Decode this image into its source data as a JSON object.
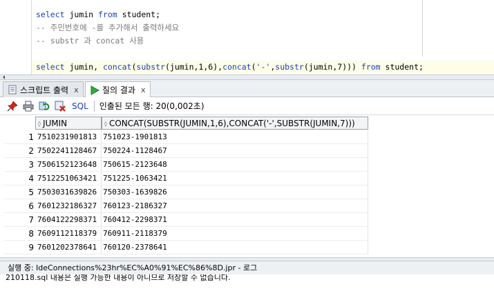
{
  "editor": {
    "lines": [
      {
        "parts": [
          {
            "t": "kw",
            "v": "select"
          },
          {
            "t": "id",
            "v": " jumin "
          },
          {
            "t": "kw",
            "v": "from"
          },
          {
            "t": "id",
            "v": " student;"
          }
        ]
      },
      {
        "parts": [
          {
            "t": "cmt",
            "v": "-- 주민번호에 -를 추가해서 출력하세요"
          }
        ]
      },
      {
        "parts": [
          {
            "t": "cmt",
            "v": "-- substr 과 concat 사용"
          }
        ]
      },
      {
        "parts": [
          {
            "t": "kw",
            "v": "select"
          },
          {
            "t": "id",
            "v": " jumin, "
          },
          {
            "t": "kw",
            "v": "concat"
          },
          {
            "t": "id",
            "v": "("
          },
          {
            "t": "kw",
            "v": "substr"
          },
          {
            "t": "id",
            "v": "(jumin,1,6),"
          },
          {
            "t": "kw",
            "v": "concat"
          },
          {
            "t": "id",
            "v": "("
          },
          {
            "t": "str",
            "v": "'-'"
          },
          {
            "t": "id",
            "v": ","
          },
          {
            "t": "kw",
            "v": "substr"
          },
          {
            "t": "id",
            "v": "(jumin,7))) "
          },
          {
            "t": "kw",
            "v": "from"
          },
          {
            "t": "id",
            "v": " student;"
          }
        ]
      }
    ]
  },
  "tabs": [
    {
      "label": "스크립트 출력",
      "close": "x",
      "icon": "script-output-icon",
      "active": false
    },
    {
      "label": "질의 결과",
      "close": "x",
      "icon": "run-result-icon",
      "active": true
    }
  ],
  "toolbar": {
    "sql_label": "SQL",
    "status": "인출된 모든 행: 20(0,002초)",
    "icons": [
      "pin-icon",
      "print-icon",
      "refresh-icon",
      "cancel-icon"
    ]
  },
  "grid": {
    "columns": [
      "JUMIN",
      "CONCAT(SUBSTR(JUMIN,1,6),CONCAT('-',SUBSTR(JUMIN,7)))"
    ],
    "rows": [
      {
        "n": "1",
        "jumin": "7510231901813",
        "concat": "751023-1901813"
      },
      {
        "n": "2",
        "jumin": "7502241128467",
        "concat": "750224-1128467"
      },
      {
        "n": "3",
        "jumin": "7506152123648",
        "concat": "750615-2123648"
      },
      {
        "n": "4",
        "jumin": "7512251063421",
        "concat": "751225-1063421"
      },
      {
        "n": "5",
        "jumin": "7503031639826",
        "concat": "750303-1639826"
      },
      {
        "n": "6",
        "jumin": "7601232186327",
        "concat": "760123-2186327"
      },
      {
        "n": "7",
        "jumin": "7604122298371",
        "concat": "760412-2298371"
      },
      {
        "n": "8",
        "jumin": "7609112118379",
        "concat": "760911-2118379"
      },
      {
        "n": "9",
        "jumin": "7601202378641",
        "concat": "760120-2378641"
      }
    ]
  },
  "status_bar": {
    "text": "실행 중: IdeConnections%23hr%EC%A0%91%EC%86%8D.jpr - 로그"
  },
  "log": {
    "text": "210118.sql 내용은 실행 가능한 내용이 아니므로 저장할 수 없습니다."
  }
}
